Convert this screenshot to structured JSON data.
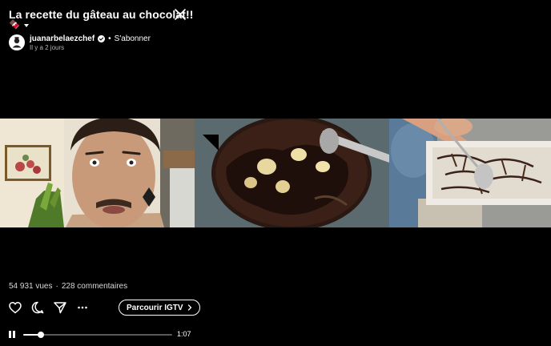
{
  "post": {
    "title": "La recette du gâteau au chocolat!!",
    "title_emoji": "🍫",
    "author": "juanarbelaezchef",
    "separator": "•",
    "subscribe_label": "S'abonner",
    "time_ago": "Il y a 2 jours"
  },
  "stats": {
    "views": "54 931 vues",
    "separator": "·",
    "comments": "228 commentaires"
  },
  "actions": {
    "browse_label": "Parcourir IGTV"
  },
  "player": {
    "progress": 0.12,
    "duration": "1:07"
  },
  "icons": [
    "close-icon",
    "verified-icon",
    "heart-icon",
    "comment-icon",
    "send-icon",
    "more-icon",
    "chevron-right-icon",
    "pause-icon",
    "chevron-down-icon"
  ],
  "colors": {
    "background": "#000000",
    "text": "#ffffff",
    "secondary_text": "#b4b4b4",
    "verified": "#3897f0"
  }
}
